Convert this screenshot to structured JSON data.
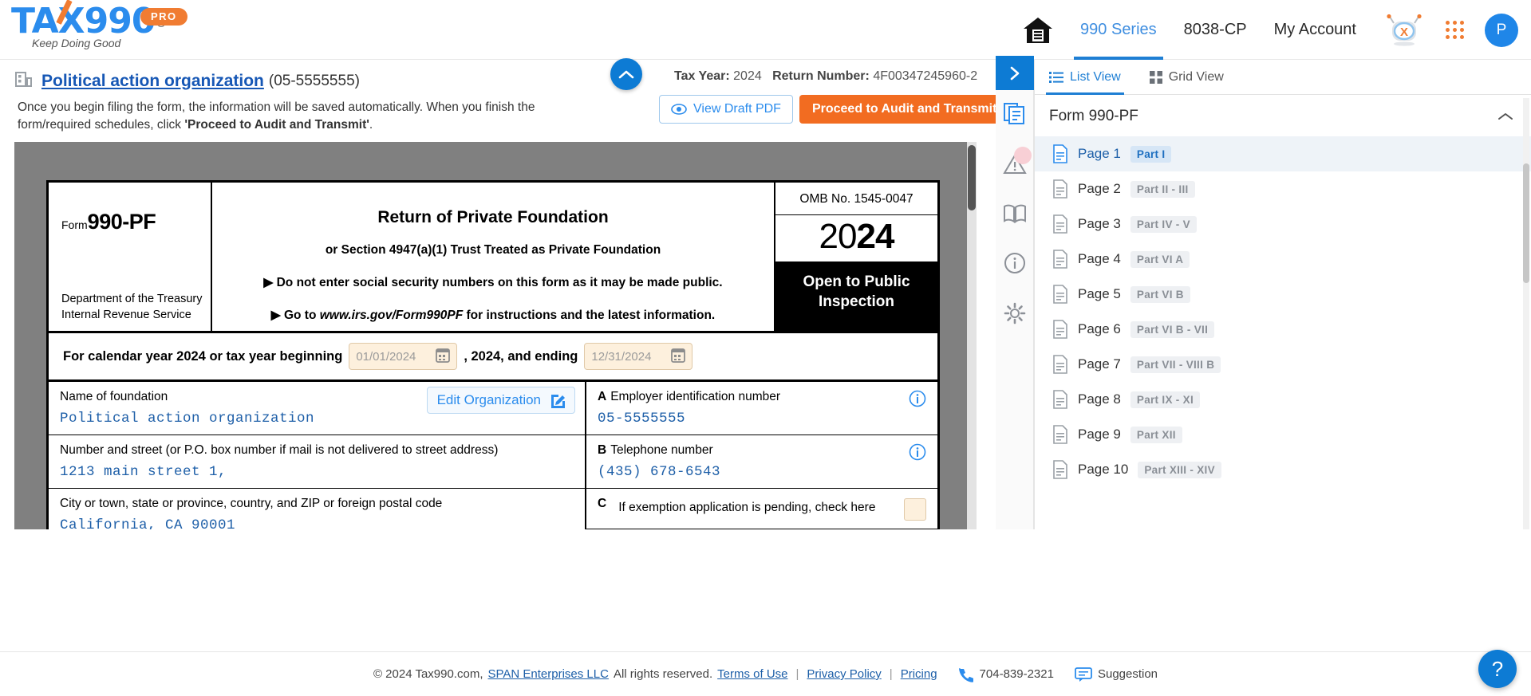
{
  "brand": {
    "logo_tax": "TA",
    "logo_x": "X",
    "logo_990": "990",
    "logo_reg": "®",
    "pro_badge": "PRO",
    "tagline": "Keep Doing Good"
  },
  "nav": {
    "home_icon": "home-icon",
    "items": [
      {
        "label": "990 Series",
        "active": true
      },
      {
        "label": "8038-CP",
        "active": false
      },
      {
        "label": "My Account",
        "active": false
      }
    ],
    "bot_icon": "robot-assistant-icon",
    "apps_icon": "apps-grid-icon",
    "avatar_initial": "P"
  },
  "subheader": {
    "org_icon": "building-icon",
    "org_name": "Political action organization",
    "org_ein": "(05-5555555)",
    "note_part1": "Once you begin filing the form, the information will be saved automatically. When you finish the form/required schedules, click ",
    "note_bold": "'Proceed to Audit and Transmit'",
    "note_end": ".",
    "collapse_icon": "chevron-up-icon",
    "tax_year_label": "Tax Year:",
    "tax_year_value": "2024",
    "return_number_label": "Return Number:",
    "return_number_value": "4F00347245960-2",
    "view_pdf_label": "View Draft PDF",
    "view_pdf_icon": "eye-icon",
    "proceed_label": "Proceed to Audit and Transmit"
  },
  "form": {
    "form_word": "Form",
    "form_number": "990-PF",
    "dept_line1": "Department of the Treasury",
    "dept_line2": "Internal Revenue Service",
    "title": "Return of Private Foundation",
    "subtitle": "or Section 4947(a)(1) Trust Treated as Private Foundation",
    "bullet1": "▶ Do not enter social security numbers on this form as it may be made public.",
    "bullet2_pre": "▶ Go to ",
    "bullet2_link": "www.irs.gov/Form990PF",
    "bullet2_post": " for instructions and the latest information.",
    "omb": "OMB No. 1545-0047",
    "year_light": "20",
    "year_bold": "24",
    "open_public": "Open to Public Inspection",
    "cal_text_pre": "For calendar year 2024 or tax year beginning",
    "cal_begin_value": "01/01/2024",
    "cal_text_mid": ", 2024, and ending",
    "cal_end_value": "12/31/2024",
    "calendar_icon": "calendar-icon",
    "name_label": "Name of foundation",
    "name_value": "Political action organization",
    "edit_org_label": "Edit Organization",
    "edit_org_icon": "edit-pencil-icon",
    "street_label": "Number and street (or P.O. box number if mail is not delivered to street address)",
    "street_value": "1213 main street 1,",
    "city_label": "City or town, state or province, country, and ZIP or foreign postal code",
    "city_value": "California, CA 90001",
    "ein_letter": "A",
    "ein_label": "Employer identification number",
    "ein_value": "05-5555555",
    "phone_letter": "B",
    "phone_label": "Telephone number",
    "phone_value": "(435) 678-6543",
    "exempt_letter": "C",
    "exempt_label": "If exemption application is pending, check here",
    "info_icon": "info-circle-icon"
  },
  "rail": {
    "expand_icon": "chevron-right-icon",
    "icons": [
      {
        "name": "documents-icon",
        "badge": false
      },
      {
        "name": "warning-triangle-icon",
        "badge": true
      },
      {
        "name": "book-open-icon",
        "badge": false
      },
      {
        "name": "info-circle-icon",
        "badge": false
      },
      {
        "name": "gear-icon",
        "badge": false
      }
    ]
  },
  "panel": {
    "list_view_label": "List View",
    "list_view_icon": "list-icon",
    "grid_view_label": "Grid View",
    "grid_view_icon": "grid-icon",
    "form_title": "Form 990-PF",
    "collapse_icon": "chevron-up-icon",
    "page_icon": "page-doc-icon",
    "pages": [
      {
        "name": "Page 1",
        "part": "Part I",
        "selected": true
      },
      {
        "name": "Page 2",
        "part": "Part II - III",
        "selected": false
      },
      {
        "name": "Page 3",
        "part": "Part IV - V",
        "selected": false
      },
      {
        "name": "Page 4",
        "part": "Part VI A",
        "selected": false
      },
      {
        "name": "Page 5",
        "part": "Part VI B",
        "selected": false
      },
      {
        "name": "Page 6",
        "part": "Part VI B - VII",
        "selected": false
      },
      {
        "name": "Page 7",
        "part": "Part VII - VIII B",
        "selected": false
      },
      {
        "name": "Page 8",
        "part": "Part IX - XI",
        "selected": false
      },
      {
        "name": "Page 9",
        "part": "Part XII",
        "selected": false
      },
      {
        "name": "Page 10",
        "part": "Part XIII - XIV",
        "selected": false
      }
    ]
  },
  "footer": {
    "copyright": "© 2024 Tax990.com,",
    "company": "SPAN Enterprises LLC",
    "rights": "All rights reserved.",
    "terms": "Terms of Use",
    "privacy": "Privacy Policy",
    "pricing": "Pricing",
    "phone_icon": "phone-icon",
    "phone": "704-839-2321",
    "suggestion_icon": "chat-icon",
    "suggestion": "Suggestion",
    "help_label": "?"
  },
  "colors": {
    "brand_blue": "#2b8ced",
    "brand_orange": "#f07c32",
    "accent_blue": "#1f7fd4",
    "field_bg": "#fdf0dd"
  }
}
